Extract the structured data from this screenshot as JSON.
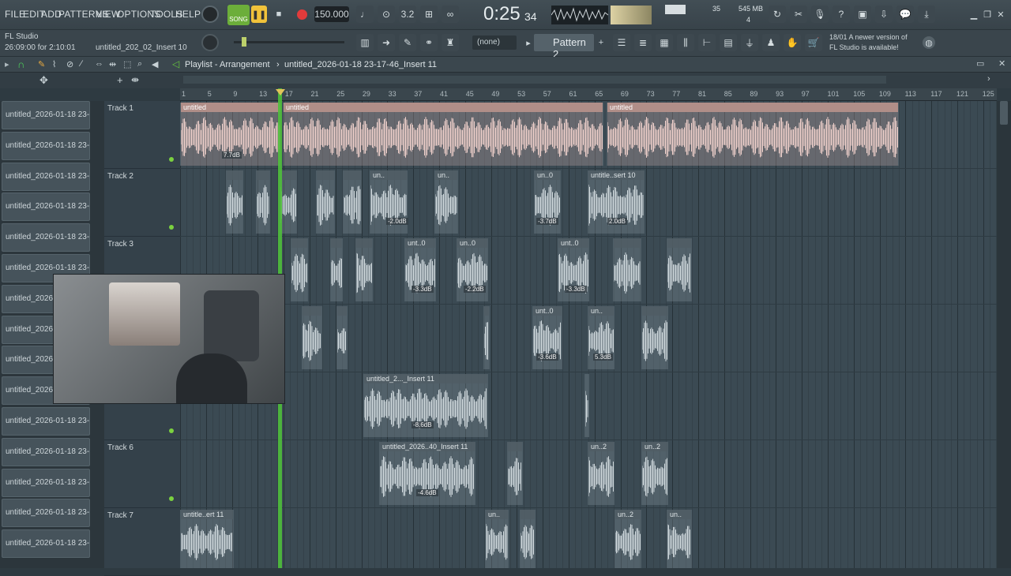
{
  "menu": [
    "FILE",
    "EDIT",
    "ADD",
    "PATTERNS",
    "VIEW",
    "OPTIONS",
    "TOOLS",
    "HELP"
  ],
  "transport": {
    "mode": "SONG",
    "tempo": "150.000",
    "time": "0:25",
    "time_sub": "34",
    "cpu": "35",
    "ram": "545 MB",
    "poly": "4"
  },
  "info": {
    "app": "FL Studio",
    "project_time": "26:09:00 for 2:10:01",
    "project_name": "untitled_202_02_Insert 10"
  },
  "row2": {
    "pattern_select": "(none)",
    "pattern": "Pattern 2",
    "news_line1": "18/01 A newer version of",
    "news_line2": "FL Studio is available!"
  },
  "playlist": {
    "title": "Playlist - Arrangement",
    "arrangement": "untitled_2026-01-18 23-17-46_Insert 11"
  },
  "ruler_ticks": [
    "1",
    "5",
    "9",
    "13",
    "17",
    "21",
    "25",
    "29",
    "33",
    "37",
    "41",
    "45",
    "49",
    "53",
    "57",
    "61",
    "65",
    "69",
    "73",
    "77",
    "81",
    "85",
    "89",
    "93",
    "97",
    "101",
    "105",
    "109",
    "113",
    "117",
    "121",
    "125"
  ],
  "clip_list": [
    "untitled_2026-01-18 23-",
    "untitled_2026-01-18 23-",
    "untitled_2026-01-18 23-",
    "untitled_2026-01-18 23-",
    "untitled_2026-01-18 23-",
    "untitled_2026-01-18 23-",
    "untitled_2026-0",
    "untitled_2026-0",
    "untitled_2026-0",
    "untitled_2026-0",
    "untitled_2026-01-18 23-",
    "untitled_2026-01-18 23-",
    "untitled_2026-01-18 23-",
    "untitled_2026-01-18 23-",
    "untitled_2026-01-18 23-"
  ],
  "tracks": [
    "Track 1",
    "Track 2",
    "Track 3",
    "",
    "",
    "Track 6",
    "Track 7"
  ],
  "clips": {
    "t1a": "untitled",
    "t1b": "untitled",
    "t1c": "untitled",
    "t1_db": "7.7dB",
    "t2_db1": "-2.0dB",
    "t2_db2": "-3.7dB",
    "t2_db3": "2.0dB",
    "t2_a": "un..",
    "t2_b": "un..",
    "t2_c": "un..0",
    "t2_d": "untitle..sert 10",
    "t3_a": "unt..0",
    "t3_b": "un..0",
    "t3_c": "unt..0",
    "t3_db1": "-3.3dB",
    "t3_db2": "-2.2dB",
    "t3_db3": "-3.3dB",
    "t4_a": "unt..0",
    "t4_b": "un..",
    "t4_db1": "-3.6dB",
    "t4_db2": "5.3dB",
    "t5_a": "untitled_2..._Insert 11",
    "t5_db": "-8.6dB",
    "t6_a": "untitled_2026..40_Insert 11",
    "t6_b": "un..2",
    "t6_c": "un..2",
    "t6_db": "-4.6dB",
    "t7_a": "untitle..ert 11",
    "t7_b": "un..",
    "t7_c": "un..2",
    "t7_d": "un.."
  }
}
